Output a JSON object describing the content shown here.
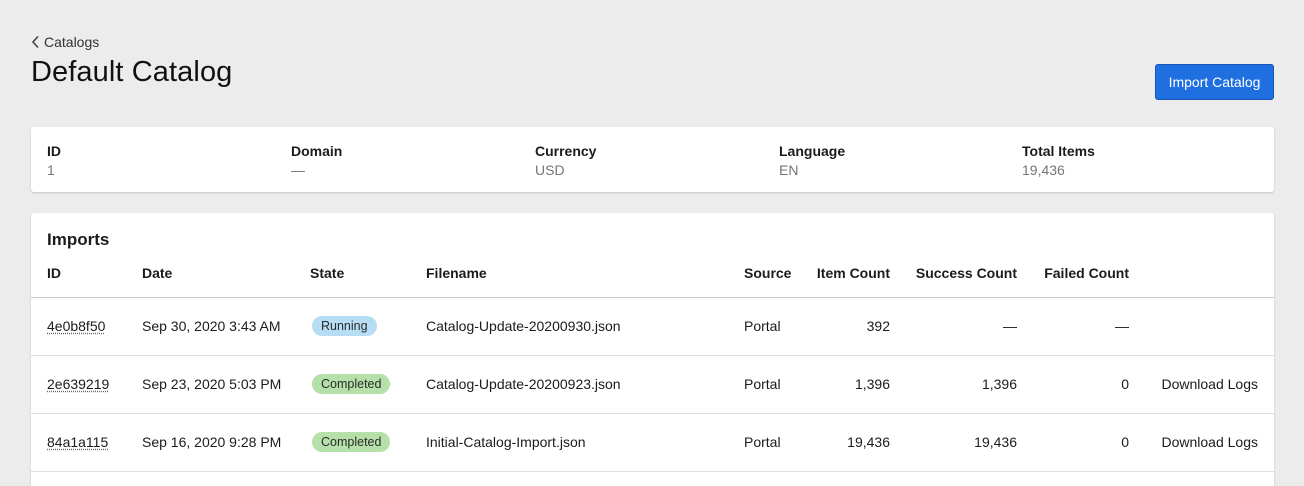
{
  "breadcrumb": {
    "label": "Catalogs"
  },
  "page": {
    "title": "Default Catalog"
  },
  "actions": {
    "import_label": "Import Catalog"
  },
  "info": {
    "id": {
      "label": "ID",
      "value": "1"
    },
    "domain": {
      "label": "Domain",
      "value": "—"
    },
    "currency": {
      "label": "Currency",
      "value": "USD"
    },
    "language": {
      "label": "Language",
      "value": "EN"
    },
    "total_items": {
      "label": "Total Items",
      "value": "19,436"
    }
  },
  "imports": {
    "title": "Imports",
    "columns": {
      "id": "ID",
      "date": "Date",
      "state": "State",
      "filename": "Filename",
      "source": "Source",
      "item_count": "Item Count",
      "success_count": "Success Count",
      "failed_count": "Failed Count"
    },
    "rows": [
      {
        "id": "4e0b8f50",
        "date": "Sep 30, 2020 3:43 AM",
        "state": "Running",
        "filename": "Catalog-Update-20200930.json",
        "source": "Portal",
        "item_count": "392",
        "success_count": "—",
        "failed_count": "—",
        "action": ""
      },
      {
        "id": "2e639219",
        "date": "Sep 23, 2020 5:03 PM",
        "state": "Completed",
        "filename": "Catalog-Update-20200923.json",
        "source": "Portal",
        "item_count": "1,396",
        "success_count": "1,396",
        "failed_count": "0",
        "action": "Download Logs"
      },
      {
        "id": "84a1a115",
        "date": "Sep 16, 2020 9:28 PM",
        "state": "Completed",
        "filename": "Initial-Catalog-Import.json",
        "source": "Portal",
        "item_count": "19,436",
        "success_count": "19,436",
        "failed_count": "0",
        "action": "Download Logs"
      }
    ]
  },
  "colors": {
    "primary": "#1f6fe0",
    "link": "#1d6dd6",
    "running_badge": "#b7ddf5",
    "completed_badge": "#b5e0a9",
    "background": "#ececec"
  },
  "icons": {
    "back": "chevron-left-icon"
  }
}
